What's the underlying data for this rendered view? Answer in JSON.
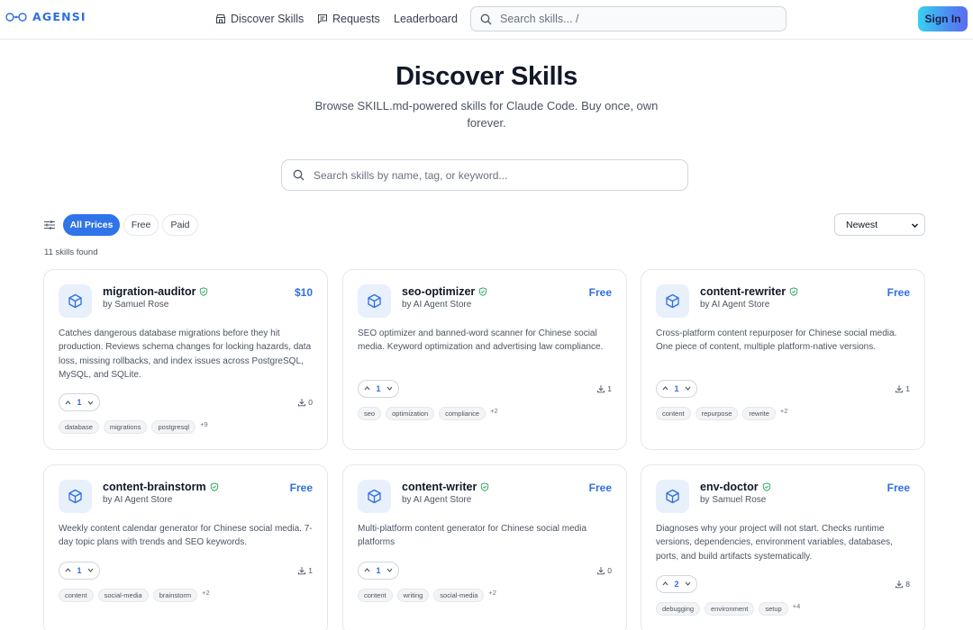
{
  "nav": {
    "brand": "AGENSI",
    "links": [
      {
        "label": "Discover Skills",
        "icon": "storefront-icon"
      },
      {
        "label": "Requests",
        "icon": "message-square-icon"
      },
      {
        "label": "Leaderboard",
        "icon": ""
      }
    ],
    "search_placeholder": "Search skills...  /",
    "sign_in": "Sign In"
  },
  "hero": {
    "title": "Discover Skills",
    "subtitle": "Browse SKILL.md-powered skills for Claude Code. Buy once, own forever.",
    "search_placeholder": "Search skills by name, tag, or keyword..."
  },
  "filters": {
    "price_options": [
      "All Prices",
      "Free",
      "Paid"
    ],
    "selected": "All Prices",
    "sort": "Newest",
    "result_count": "11 skills found"
  },
  "colors": {
    "accent": "#2f74e8",
    "price": "#2f6fe0",
    "verified": "#22a35a"
  },
  "skills": [
    {
      "name": "migration-auditor",
      "author": "by Samuel Rose",
      "price": "$10",
      "description": "Catches dangerous database migrations before they hit production. Reviews schema changes for locking hazards, data loss, missing rollbacks, and index issues across PostgreSQL, MySQL, and SQLite.",
      "votes": "1",
      "downloads": "0",
      "tags": [
        "database",
        "migrations",
        "postgresql"
      ],
      "more_tags": "+9"
    },
    {
      "name": "seo-optimizer",
      "author": "by AI Agent Store",
      "price": "Free",
      "description": "SEO optimizer and banned-word scanner for Chinese social media. Keyword optimization and advertising law compliance.",
      "votes": "1",
      "downloads": "1",
      "tags": [
        "seo",
        "optimization",
        "compliance"
      ],
      "more_tags": "+2"
    },
    {
      "name": "content-rewriter",
      "author": "by AI Agent Store",
      "price": "Free",
      "description": "Cross-platform content repurposer for Chinese social media. One piece of content, multiple platform-native versions.",
      "votes": "1",
      "downloads": "1",
      "tags": [
        "content",
        "repurpose",
        "rewrite"
      ],
      "more_tags": "+2"
    },
    {
      "name": "content-brainstorm",
      "author": "by AI Agent Store",
      "price": "Free",
      "description": "Weekly content calendar generator for Chinese social media. 7-day topic plans with trends and SEO keywords.",
      "votes": "1",
      "downloads": "1",
      "tags": [
        "content",
        "social-media",
        "brainstorm"
      ],
      "more_tags": "+2"
    },
    {
      "name": "content-writer",
      "author": "by AI Agent Store",
      "price": "Free",
      "description": "Multi-platform content generator for Chinese social media platforms",
      "votes": "1",
      "downloads": "0",
      "tags": [
        "content",
        "writing",
        "social-media"
      ],
      "more_tags": "+2"
    },
    {
      "name": "env-doctor",
      "author": "by Samuel Rose",
      "price": "Free",
      "description": "Diagnoses why your project will not start. Checks runtime versions, dependencies, environment variables, databases, ports, and build artifacts systematically.",
      "votes": "2",
      "downloads": "8",
      "tags": [
        "debugging",
        "environment",
        "setup"
      ],
      "more_tags": "+4"
    }
  ]
}
